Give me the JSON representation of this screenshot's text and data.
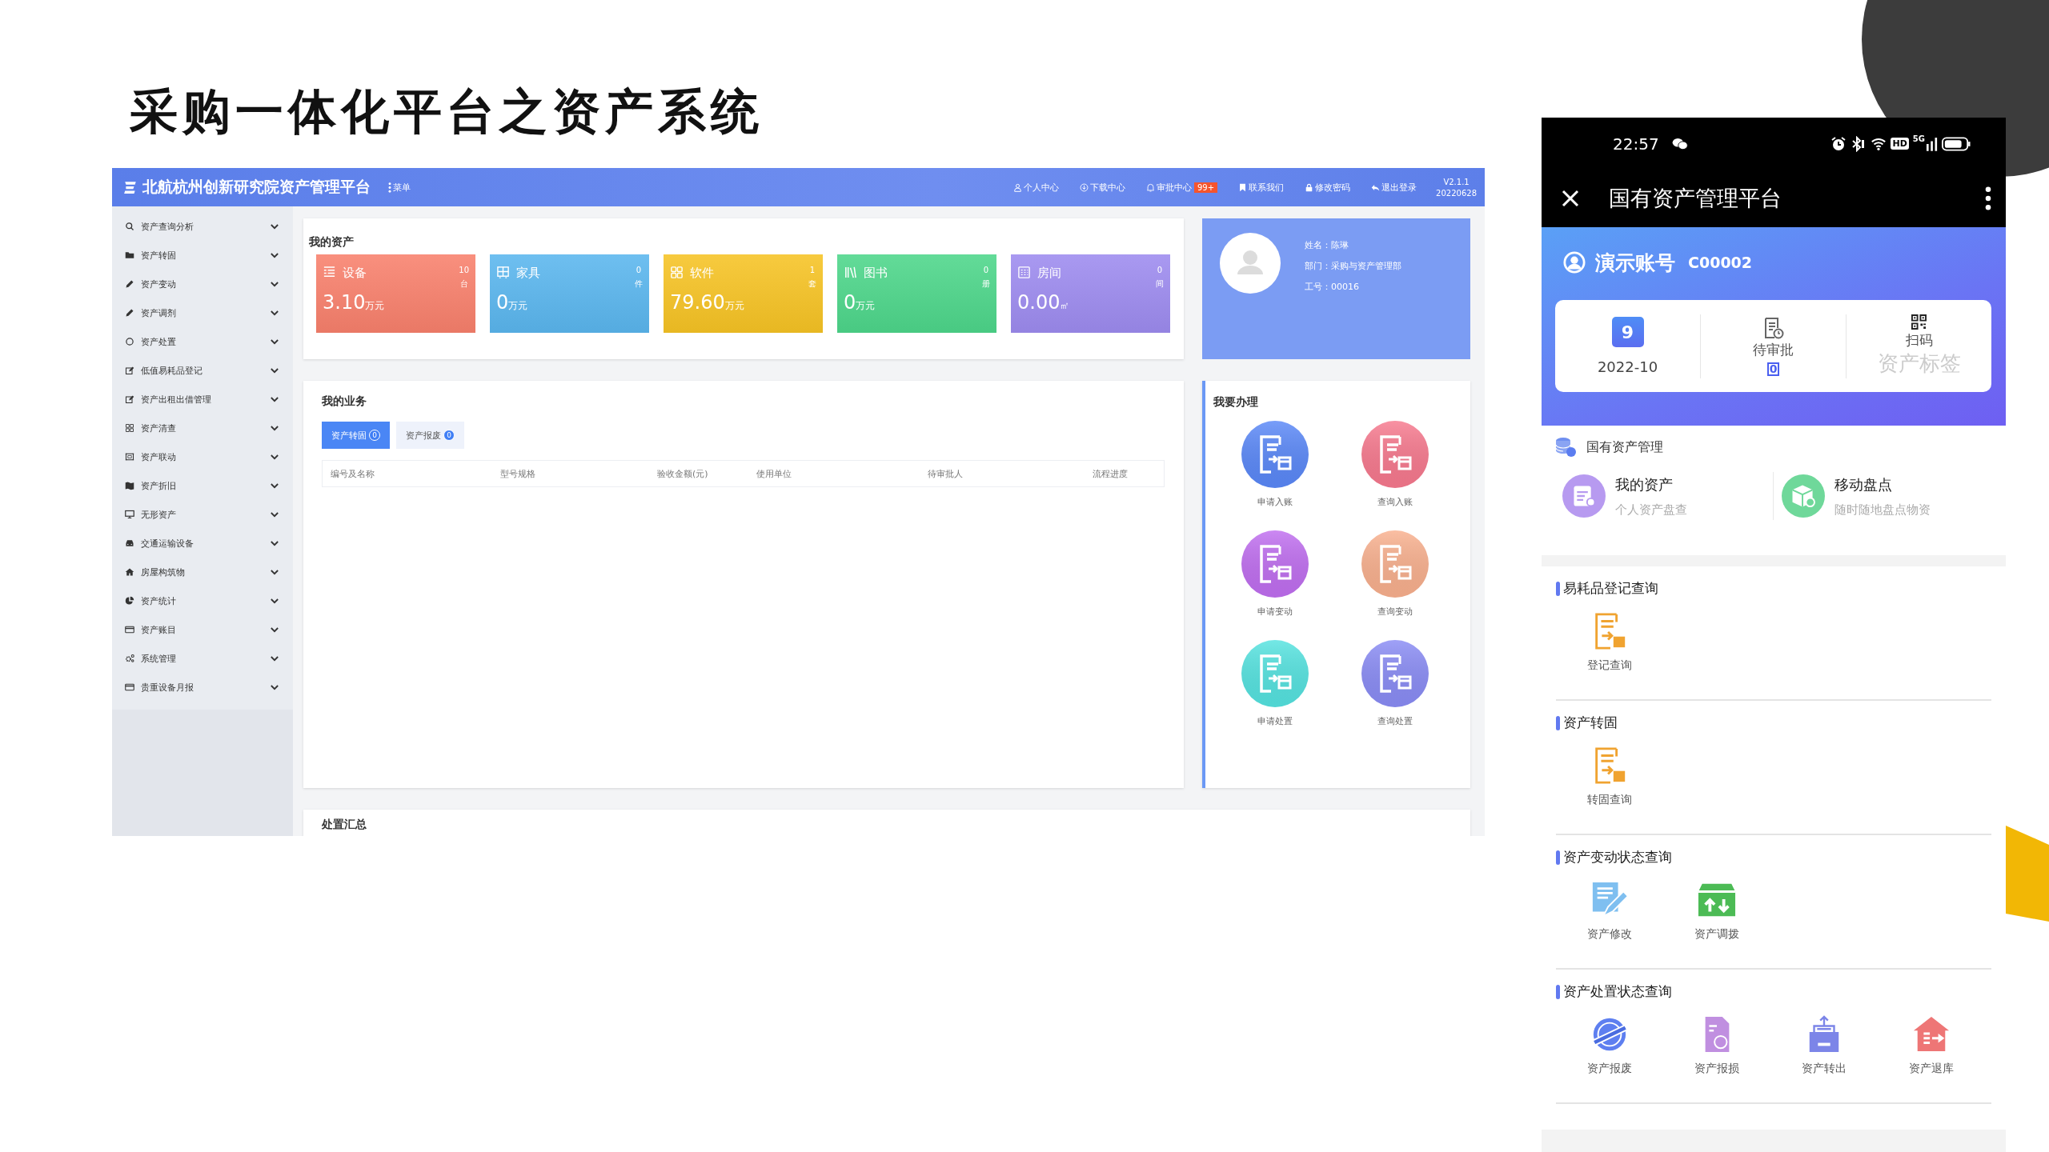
{
  "slide_title": "采购一体化平台之资产系统",
  "desktop": {
    "header": {
      "app_title": "北航杭州创新研究院资产管理平台",
      "menu": "菜单",
      "nav": [
        {
          "label": "个人中心"
        },
        {
          "label": "下载中心"
        },
        {
          "label": "审批中心",
          "badge": "99+"
        },
        {
          "label": "联系我们"
        },
        {
          "label": "修改密码"
        },
        {
          "label": "退出登录"
        }
      ],
      "version": "V2.1.1",
      "build": "20220628"
    },
    "sidebar": {
      "items": [
        "资产查询分析",
        "资产转固",
        "资产变动",
        "资产调剂",
        "资产处置",
        "低值易耗品登记",
        "资产出租出借管理",
        "资产清查",
        "资产联动",
        "资产折旧",
        "无形资产",
        "交通运输设备",
        "房屋构筑物",
        "资产统计",
        "资产账目",
        "系统管理",
        "贵重设备月报"
      ]
    },
    "my_assets": {
      "title": "我的资产",
      "cards": [
        {
          "label": "设备",
          "count": "10",
          "unit": "台",
          "value": "3.10",
          "value_unit": "万元",
          "color": "#f8806c"
        },
        {
          "label": "家具",
          "count": "0",
          "unit": "件",
          "value": "0",
          "value_unit": "万元",
          "color": "#5ab6ee"
        },
        {
          "label": "软件",
          "count": "1",
          "unit": "套",
          "value": "79.60",
          "value_unit": "万元",
          "color": "#f6c324"
        },
        {
          "label": "图书",
          "count": "0",
          "unit": "册",
          "value": "0",
          "value_unit": "万元",
          "color": "#4dd68a"
        },
        {
          "label": "房间",
          "count": "0",
          "unit": "间",
          "value": "0.00",
          "value_unit": "㎡",
          "color": "#9d8bef"
        }
      ]
    },
    "profile": {
      "lines": [
        "姓名：陈琳",
        "部门：采购与资产管理部",
        "工号：00016"
      ]
    },
    "business": {
      "title": "我的业务",
      "tabs": [
        {
          "label": "资产转固",
          "count": "0",
          "selected": true
        },
        {
          "label": "资产报废",
          "count": "0",
          "selected": false
        }
      ],
      "columns": [
        "编号及名称",
        "型号规格",
        "验收金额(元)",
        "使用单位",
        "待审批人",
        "流程进度"
      ]
    },
    "actions": {
      "title": "我要办理",
      "items": [
        {
          "label": "申请入账",
          "color": "#5a88f8"
        },
        {
          "label": "查询入账",
          "color": "#f7798e"
        },
        {
          "label": "申请变动",
          "color": "#c06ef0"
        },
        {
          "label": "查询变动",
          "color": "#f9b08e"
        },
        {
          "label": "申请处置",
          "color": "#55e3e0"
        },
        {
          "label": "查询处置",
          "color": "#8a8cf5"
        }
      ]
    },
    "summary": {
      "title": "处置汇总"
    }
  },
  "phone": {
    "status": {
      "time": "22:57",
      "hd": "HD",
      "network": "5G"
    },
    "title": "国有资产管理平台",
    "account": {
      "name": "演示账号",
      "code": "C00002"
    },
    "quick": [
      {
        "kind": "calendar",
        "day": "9",
        "label": "2022-10"
      },
      {
        "kind": "pending",
        "label": "待审批",
        "count": "0"
      },
      {
        "kind": "scan",
        "label": "扫码",
        "sublabel": "资产标签"
      }
    ],
    "section_title": "国有资产管理",
    "tiles": [
      {
        "title": "我的资产",
        "subtitle": "个人资产盘查"
      },
      {
        "title": "移动盘点",
        "subtitle": "随时随地盘点物资"
      }
    ],
    "groups": [
      {
        "title": "易耗品登记查询",
        "items": [
          "登记查询"
        ]
      },
      {
        "title": "资产转固",
        "items": [
          "转固查询"
        ]
      },
      {
        "title": "资产变动状态查询",
        "items": [
          "资产修改",
          "资产调拨"
        ]
      },
      {
        "title": "资产处置状态查询",
        "items": [
          "资产报废",
          "资产报损",
          "资产转出",
          "资产退库"
        ]
      }
    ]
  }
}
